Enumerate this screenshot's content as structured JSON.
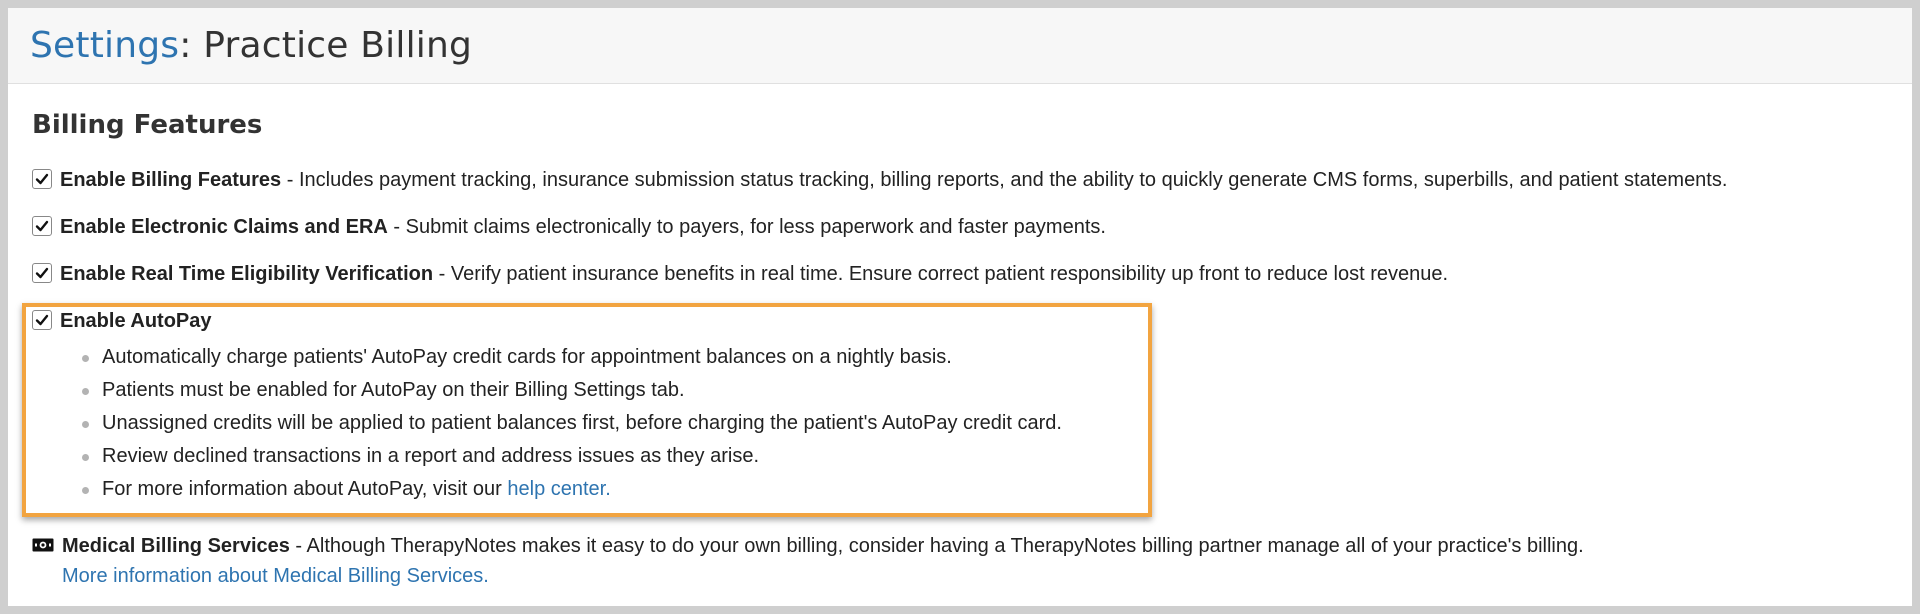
{
  "header": {
    "crumb": "Settings",
    "separator": ":",
    "title": " Practice Billing"
  },
  "section": {
    "title": "Billing Features"
  },
  "features": [
    {
      "name": "Enable Billing Features",
      "description": " - Includes payment tracking, insurance submission status tracking, billing reports, and the ability to quickly generate CMS forms, superbills, and patient statements.",
      "checked": true
    },
    {
      "name": "Enable Electronic Claims and ERA",
      "description": " - Submit claims electronically to payers, for less paperwork and faster payments.",
      "checked": true
    },
    {
      "name": "Enable Real Time Eligibility Verification",
      "description": " - Verify patient insurance benefits in real time. Ensure correct patient responsibility up front to reduce lost revenue.",
      "checked": true
    },
    {
      "name": "Enable AutoPay",
      "checked": true
    }
  ],
  "autopay_bullets": [
    "Automatically charge patients' AutoPay credit cards for appointment balances on a nightly basis.",
    "Patients must be enabled for AutoPay on their Billing Settings tab.",
    "Unassigned credits will be applied to patient balances first, before charging the patient's AutoPay credit card.",
    "Review declined transactions in a report and address issues as they arise."
  ],
  "autopay_info": {
    "text": "For more information about AutoPay, visit our ",
    "link": "help center."
  },
  "medical_billing": {
    "name": "Medical Billing Services",
    "description": " - Although TherapyNotes makes it easy to do your own billing, consider having a TherapyNotes billing partner manage all of your practice's billing.",
    "link": "More information about Medical Billing Services."
  },
  "colors": {
    "link": "#2e74b0",
    "highlight": "#f2a440"
  },
  "icons": {
    "checkbox": "check-icon",
    "money": "money-icon"
  }
}
